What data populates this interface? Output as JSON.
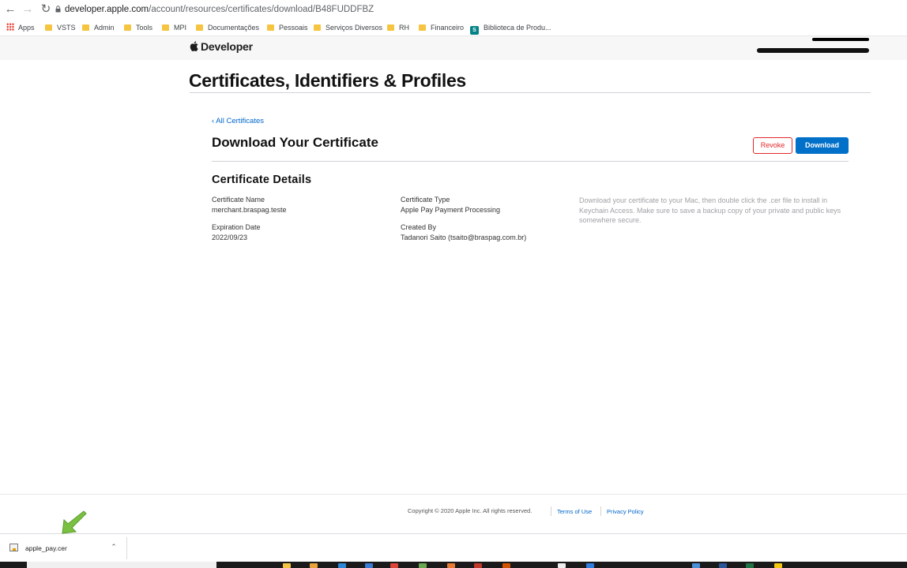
{
  "browser": {
    "url_host": "developer.apple.com",
    "url_path": "/account/resources/certificates/download/B48FUDDFBZ",
    "bookmarks": [
      "Apps",
      "VSTS",
      "Admin",
      "Tools",
      "MPI",
      "Documentações",
      "Pessoais",
      "Serviços Diversos",
      "RH",
      "Financeiro",
      "Biblioteca de Produ..."
    ],
    "sharepoint_letter": "S"
  },
  "header": {
    "brand": "Developer"
  },
  "page": {
    "title": "Certificates, Identifiers & Profiles",
    "back_link": "‹ All Certificates",
    "section_title": "Download Your Certificate",
    "revoke_label": "Revoke",
    "download_label": "Download",
    "details_title": "Certificate Details",
    "fields": {
      "name_label": "Certificate Name",
      "name_value": "merchant.braspag.teste",
      "type_label": "Certificate Type",
      "type_value": "Apple Pay Payment Processing",
      "expiration_label": "Expiration Date",
      "expiration_value": "2022/09/23",
      "created_label": "Created By",
      "created_value": "Tadanori Saito (tsaito@braspag.com.br)"
    },
    "info": "Download your certificate to your Mac, then double click the .cer file to install in Keychain Access. Make sure to save a backup copy of your private and public keys somewhere secure."
  },
  "footer": {
    "copyright": "Copyright © 2020 Apple Inc. All rights reserved.",
    "terms": "Terms of Use",
    "privacy": "Privacy Policy"
  },
  "downloads": {
    "filename": "apple_pay.cer"
  },
  "colors": {
    "link": "#0066cc",
    "primary_button": "#0070c9",
    "revoke": "#e3282a",
    "annotation_arrow": "#7ac142"
  }
}
